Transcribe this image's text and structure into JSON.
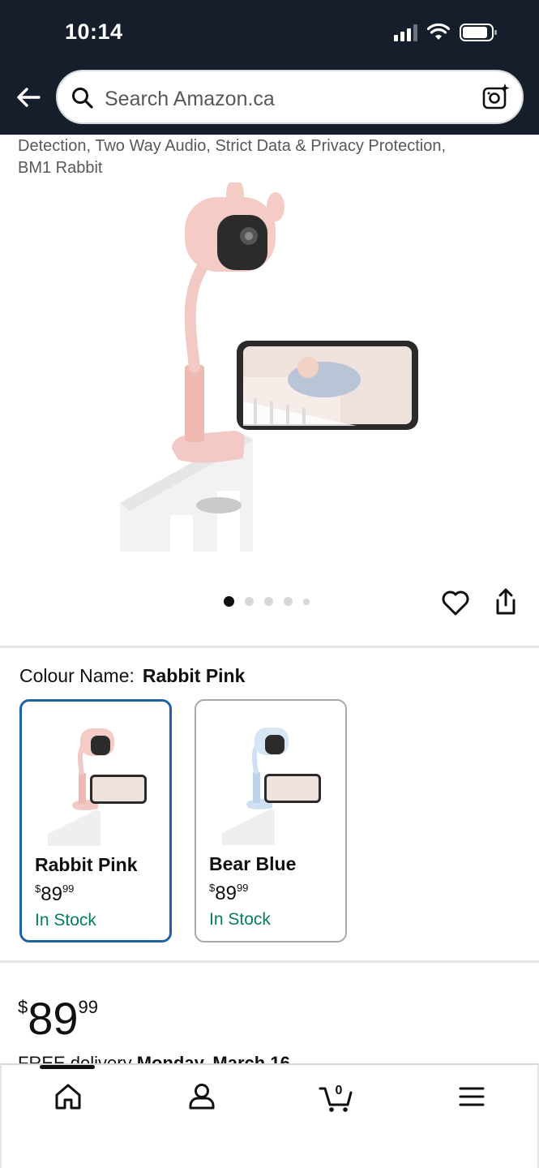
{
  "status_bar": {
    "time": "10:14"
  },
  "header": {
    "search_placeholder": "Search Amazon.ca"
  },
  "product": {
    "title_snippet_line1": "Detection, Two Way Audio, Strict Data & Privacy Protection,",
    "title_snippet_line2": "BM1 Rabbit",
    "image_count": 5,
    "active_image_index": 0
  },
  "colour": {
    "label": "Colour Name:",
    "selected": "Rabbit Pink",
    "options": [
      {
        "name": "Rabbit Pink",
        "price_symbol": "$",
        "price_whole": "89",
        "price_fraction": "99",
        "stock": "In Stock",
        "color": "#f2c9c4"
      },
      {
        "name": "Bear Blue",
        "price_symbol": "$",
        "price_whole": "89",
        "price_fraction": "99",
        "stock": "In Stock",
        "color": "#cfe0f0"
      }
    ]
  },
  "price": {
    "symbol": "$",
    "whole": "89",
    "fraction": "99"
  },
  "delivery": {
    "prefix": "FREE delivery",
    "date": "Monday, March 16"
  },
  "colors": {
    "header_bg": "#161e2b",
    "in_stock": "#067d62",
    "selected_border": "#2162a1"
  },
  "bottom_nav": [
    "home-icon",
    "account-icon",
    "cart-icon",
    "menu-icon"
  ],
  "cart": {
    "count": "0"
  }
}
